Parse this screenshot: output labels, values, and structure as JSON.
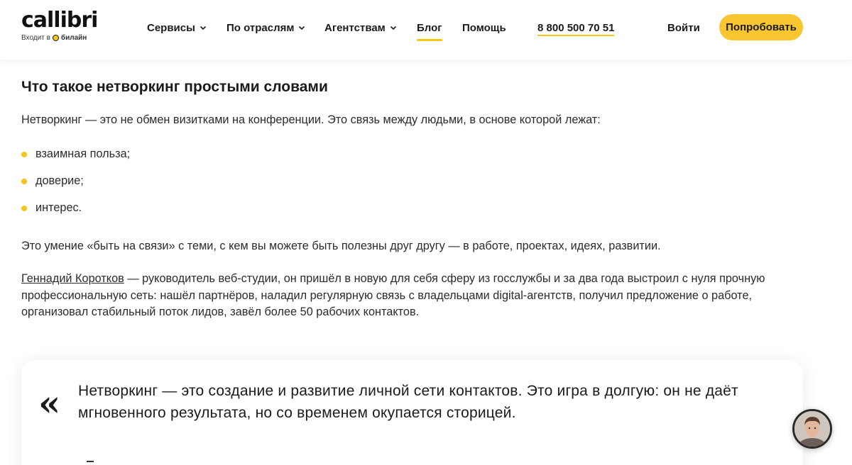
{
  "header": {
    "logo": {
      "word": "callibri",
      "sub_prefix": "Входит в",
      "sub_brand": "билайн"
    },
    "nav": [
      {
        "label": "Сервисы",
        "has_dropdown": true
      },
      {
        "label": "По отраслям",
        "has_dropdown": true
      },
      {
        "label": "Агентствам",
        "has_dropdown": true
      },
      {
        "label": "Блог",
        "has_dropdown": false,
        "active": true
      },
      {
        "label": "Помощь",
        "has_dropdown": false
      }
    ],
    "phone": "8 800 500 70 51",
    "login_label": "Войти",
    "cta_label": "Попробовать"
  },
  "article": {
    "heading": "Что такое нетворкинг простыми словами",
    "intro": "Нетворкинг — это не обмен визитками на конференции. Это связь между людьми, в основе которой лежат:",
    "bullets": [
      "взаимная польза;",
      "доверие;",
      "интерес."
    ],
    "paragraph2": "Это умение «быть на связи» с теми, с кем вы можете быть полезны друг другу — в работе, проектах, идеях, развитии.",
    "paragraph3_link": "Геннадий Коротков",
    "paragraph3_rest": " — руководитель веб-студии, он пришёл в новую для себя сферу из госслужбы и за два года выстроил с нуля прочную профессиональную сеть: нашёл партнёров, наладил регулярную связь с владельцами digital-агентств, получил предложение о работе, организовал стабильный поток лидов, завёл более 50 рабочих контактов."
  },
  "quote": {
    "mark": "«",
    "text": "Нетворкинг — это создание и развитие личной сети контактов. Это игра в долгую: он не даёт мгновенного результата, но со временем окупается сторицей."
  },
  "colors": {
    "accent": "#f9c62f",
    "text": "#1b1b1b"
  }
}
